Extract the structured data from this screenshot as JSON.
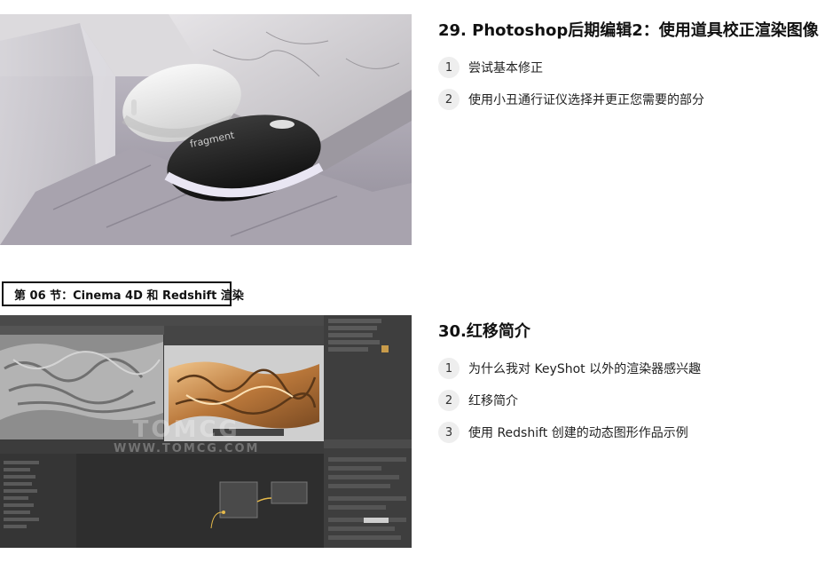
{
  "lessons": [
    {
      "title": "29. Photoshop后期编辑2：使用道具校正渲染图像",
      "items": [
        {
          "num": "1",
          "text": "尝试基本修正"
        },
        {
          "num": "2",
          "text": "使用小丑通行证仪选择并更正您需要的部分"
        }
      ]
    },
    {
      "title": "30.红移简介",
      "items": [
        {
          "num": "1",
          "text": "为什么我对 KeyShot 以外的渲染器感兴趣"
        },
        {
          "num": "2",
          "text": "红移简介"
        },
        {
          "num": "3",
          "text": "使用 Redshift 创建的动态图形作品示例"
        }
      ]
    }
  ],
  "section_label": "第 06 节：Cinema 4D 和 Redshift 渲染",
  "mouse_brand": "fragment",
  "watermark": {
    "big": "TOMCG",
    "url": "WWW.TOMCG.COM"
  }
}
